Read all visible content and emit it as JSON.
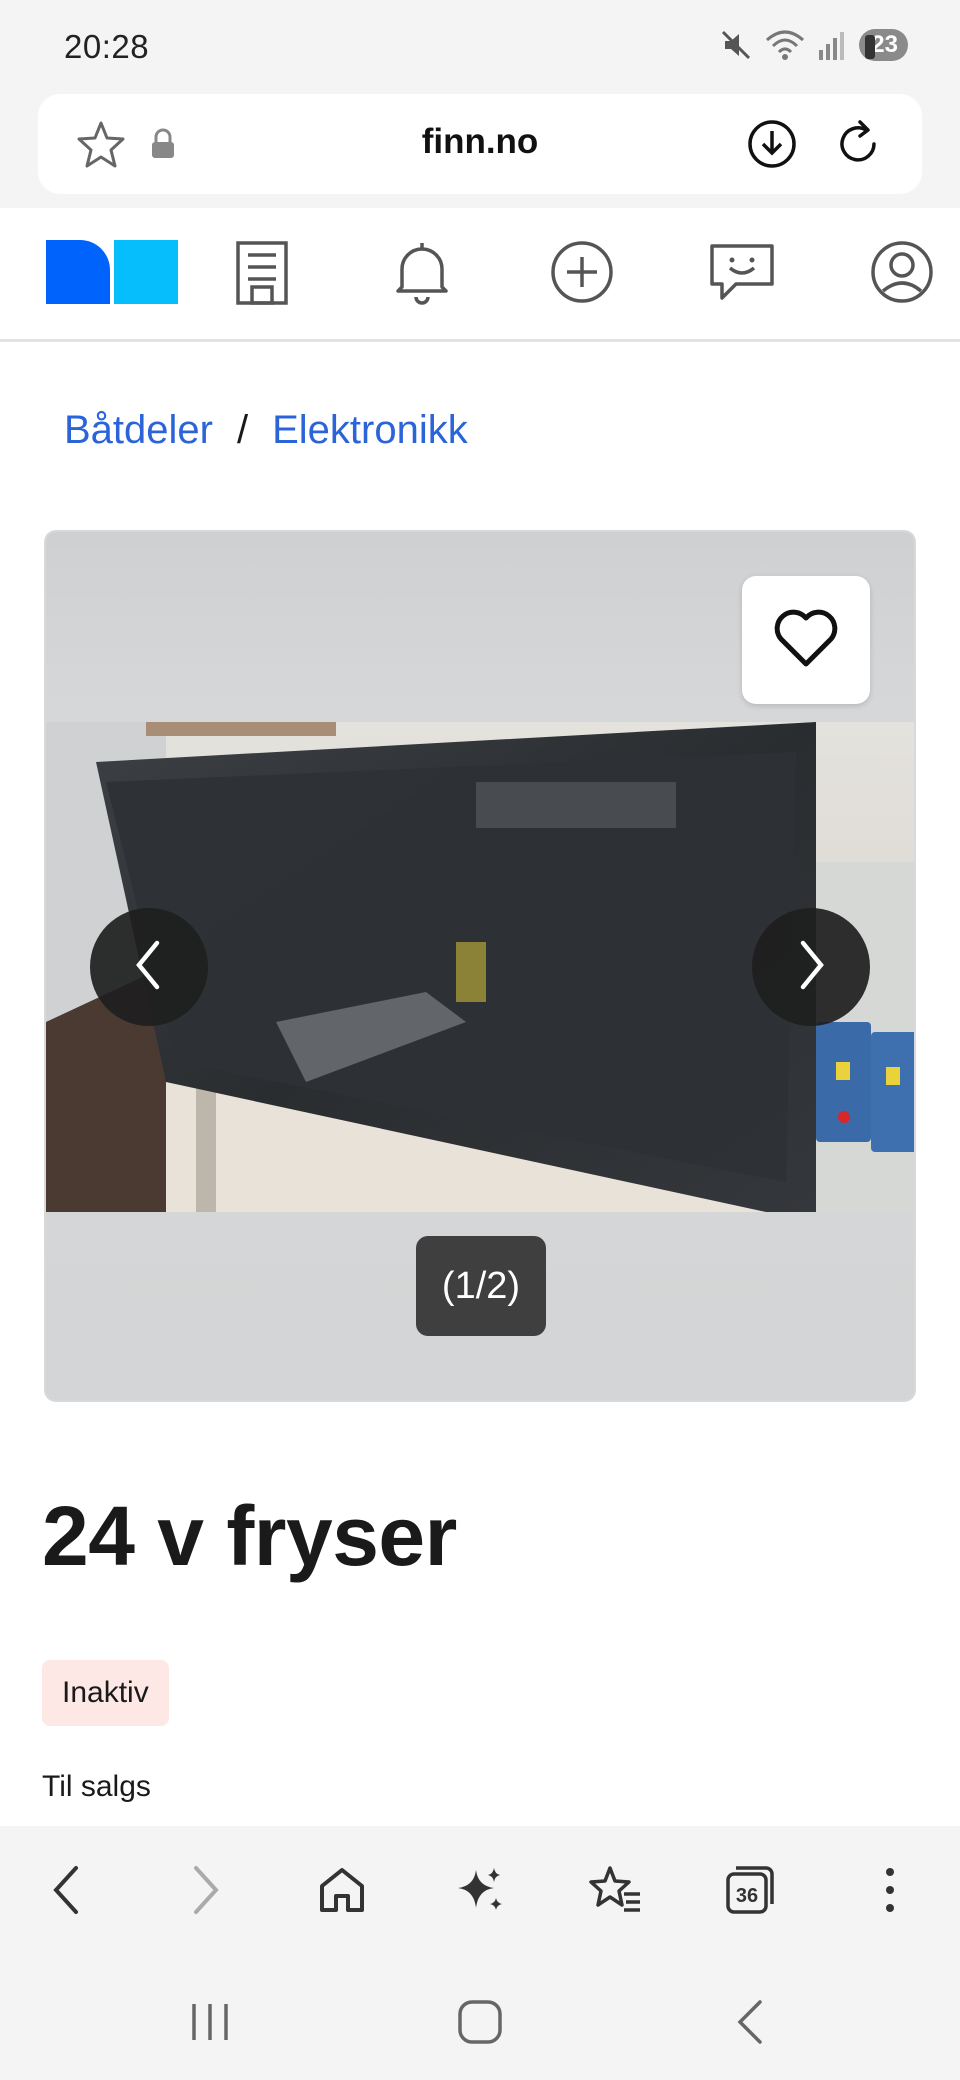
{
  "status_bar": {
    "time": "20:28",
    "battery": "23",
    "icons": [
      "mute-icon",
      "wifi-icon",
      "signal-icon",
      "battery-icon"
    ]
  },
  "browser": {
    "url": "finn.no"
  },
  "site_nav": {
    "icons": [
      "finn-logo",
      "building-icon",
      "bell-icon",
      "plus-circle-icon",
      "chat-icon",
      "profile-icon"
    ]
  },
  "breadcrumb": {
    "items": [
      "Båtdeler",
      "Elektronikk"
    ],
    "separator": "/"
  },
  "gallery": {
    "counter": "(1/2)"
  },
  "listing": {
    "title": "24 v fryser",
    "status_badge": "Inaktiv",
    "sale_type": "Til salgs"
  },
  "colors": {
    "link": "#2b64d9",
    "badge_bg": "#fde8e6",
    "logo_dark": "#0063fb",
    "logo_light": "#06befb"
  }
}
